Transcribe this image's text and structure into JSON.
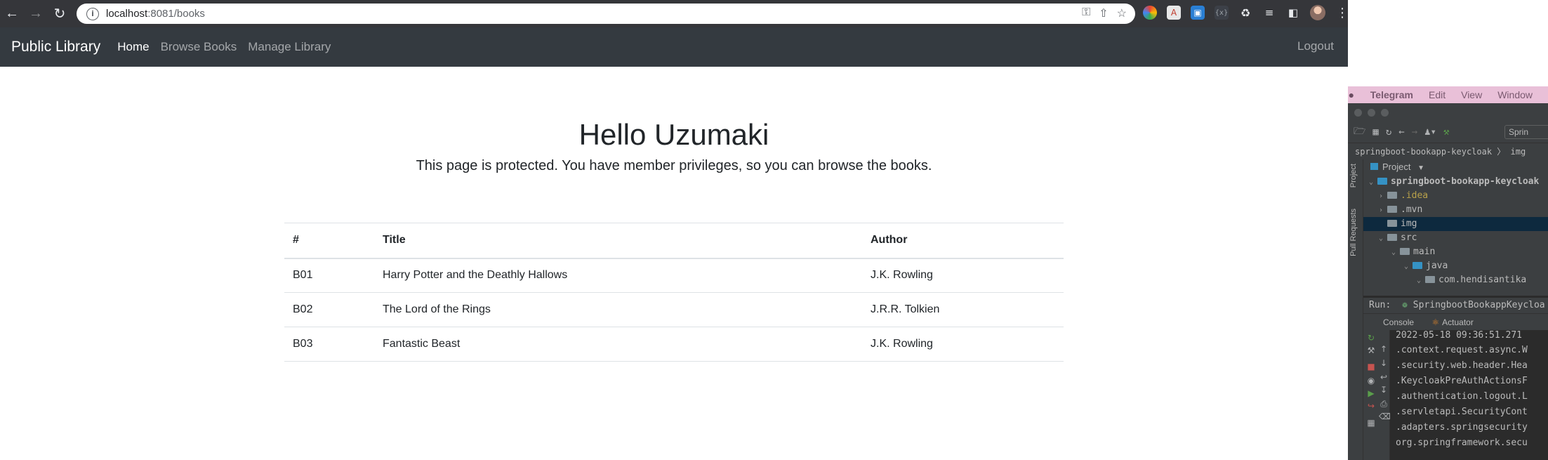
{
  "browser": {
    "url_host": "localhost",
    "url_path": ":8081/books"
  },
  "app": {
    "brand": "Public Library",
    "nav": [
      "Home",
      "Browse Books",
      "Manage Library"
    ],
    "logout": "Logout"
  },
  "page": {
    "greeting": "Hello Uzumaki",
    "message": "This page is protected. You have member privileges, so you can browse the books.",
    "table": {
      "headers": [
        "#",
        "Title",
        "Author"
      ],
      "rows": [
        [
          "B01",
          "Harry Potter and the Deathly Hallows",
          "J.K. Rowling"
        ],
        [
          "B02",
          "The Lord of the Rings",
          "J.R.R. Tolkien"
        ],
        [
          "B03",
          "Fantastic Beast",
          "J.K. Rowling"
        ]
      ]
    }
  },
  "ide": {
    "menu": [
      "Telegram",
      "Edit",
      "View",
      "Window"
    ],
    "run_config": "Sprin",
    "breadcrumb": "springboot-bookapp-keycloak 〉 img",
    "side_tabs": [
      "Project",
      "Pull Requests"
    ],
    "project_header": "Project",
    "tree": [
      {
        "label": "springboot-bookapp-keycloak",
        "level": 0,
        "expanded": true,
        "bold": true
      },
      {
        "label": ".idea",
        "level": 1,
        "expanded": false
      },
      {
        "label": ".mvn",
        "level": 1,
        "expanded": false
      },
      {
        "label": "img",
        "level": 1,
        "selected": true
      },
      {
        "label": "src",
        "level": 1,
        "expanded": true
      },
      {
        "label": "main",
        "level": 2,
        "expanded": true
      },
      {
        "label": "java",
        "level": 3,
        "expanded": true
      },
      {
        "label": "com.hendisantika",
        "level": 4,
        "expanded": true
      }
    ],
    "run_label": "Run:",
    "run_target": "SpringbootBookappKeycloa",
    "run_tabs": [
      "Console",
      "Actuator"
    ],
    "console_lines": [
      "2022-05-18 09:36:51.271",
      " .context.request.async.W",
      " .security.web.header.Hea",
      " .KeycloakPreAuthActionsF",
      " .authentication.logout.L",
      " .servletapi.SecurityCont",
      " .adapters.springsecurity",
      " org.springframework.secu"
    ]
  }
}
